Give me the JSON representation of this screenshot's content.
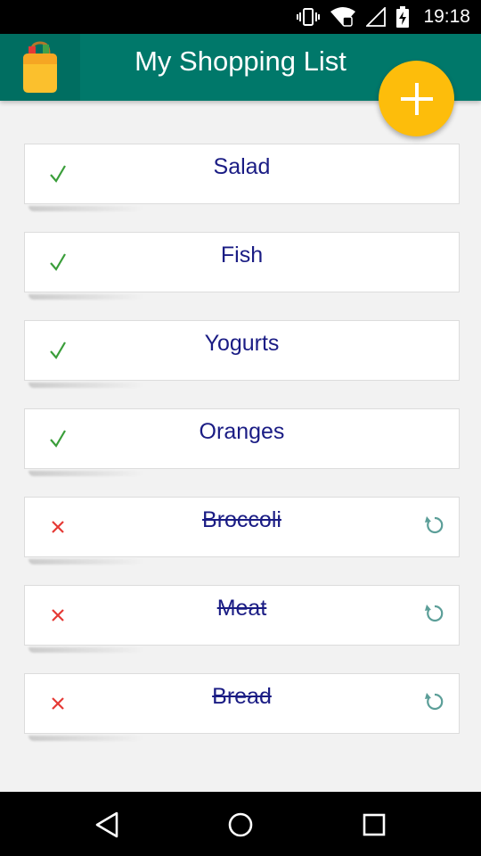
{
  "status_bar": {
    "time": "19:18",
    "icons": [
      "vibrate-icon",
      "wifi-icon",
      "signal-icon",
      "battery-charging-icon"
    ]
  },
  "app_bar": {
    "title": "My Shopping List",
    "logo_icon": "shopping-bag-icon",
    "add_icon": "plus-icon"
  },
  "colors": {
    "app_bar": "#00786a",
    "fab": "#fdbd0b",
    "item_text": "#1a1c84",
    "check": "#3a9e3a",
    "cross": "#e53935",
    "restore": "#5b9e98"
  },
  "items": [
    {
      "name": "Salad",
      "status": "checked",
      "icon": "check-icon"
    },
    {
      "name": "Fish",
      "status": "checked",
      "icon": "check-icon"
    },
    {
      "name": "Yogurts",
      "status": "checked",
      "icon": "check-icon"
    },
    {
      "name": "Oranges",
      "status": "checked",
      "icon": "check-icon"
    },
    {
      "name": "Broccoli",
      "status": "removed",
      "icon": "cross-icon",
      "action_icon": "restore-icon"
    },
    {
      "name": "Meat",
      "status": "removed",
      "icon": "cross-icon",
      "action_icon": "restore-icon"
    },
    {
      "name": "Bread",
      "status": "removed",
      "icon": "cross-icon",
      "action_icon": "restore-icon"
    }
  ],
  "nav_bar": {
    "buttons": [
      "back-icon",
      "home-icon",
      "recents-icon"
    ]
  }
}
